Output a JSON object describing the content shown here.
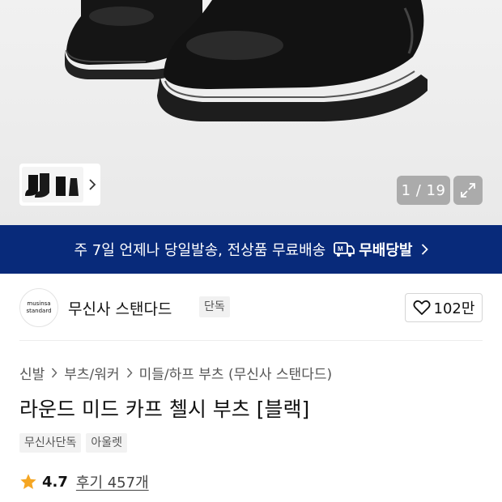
{
  "hero": {
    "counter": "1 / 19"
  },
  "banner": {
    "promo_text": "주 7일 언제나 당일발송, 전상품 무료배송",
    "brand_text": "무배당발"
  },
  "brand": {
    "logo_line1": "musinsa",
    "logo_line2": "standard",
    "name": "무신사 스탠다드",
    "badge": "단독",
    "like_count": "102만"
  },
  "breadcrumb": [
    "신발",
    "부츠/워커",
    "미들/하프 부츠 (무신사 스탠다드)"
  ],
  "product": {
    "title": "라운드 미드 카프 첼시 부츠 [블랙]",
    "tags": [
      "무신사단독",
      "아울렛"
    ],
    "rating": "4.7",
    "reviews": "후기 457개"
  },
  "colors": {
    "banner_bg": "#082a7a",
    "star": "#f5a623"
  },
  "icons": [
    "chevron-right-icon",
    "expand-icon",
    "delivery-truck-icon",
    "heart-icon",
    "star-icon"
  ]
}
